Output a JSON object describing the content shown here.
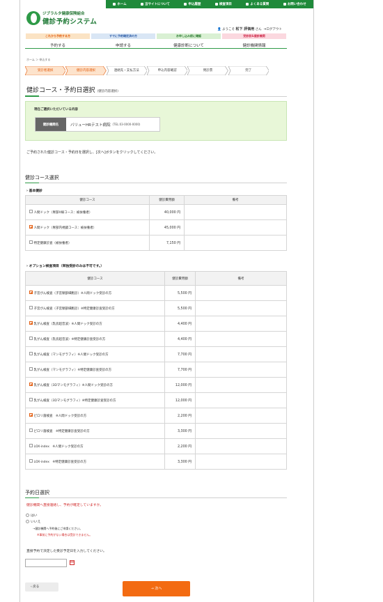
{
  "topnav": [
    "ホーム",
    "当サイトについて",
    "申込履歴",
    "検査項目",
    "よくある質問",
    "お問い合わせ"
  ],
  "logo": {
    "sub": "ジブラルタ健康保険組合",
    "title": "健診予約システム",
    "mark": "Health Check"
  },
  "user": {
    "prefix": "ようこそ",
    "name": "松下 評価用",
    "suffix": "さん",
    "logout": "ログアウト"
  },
  "menu": [
    {
      "tag": "これから予約する方",
      "label": "予約する"
    },
    {
      "tag": "すでに予約確定済の方",
      "label": "申請する"
    },
    {
      "tag": "お申し込み前に確認",
      "label": "健康診断について"
    },
    {
      "tag": "受診前&健診機関",
      "label": "健診機関情報"
    }
  ],
  "breadcrumb": "ホーム ＞ 申込する",
  "steps": [
    "受診者選択",
    "健診内容選択",
    "連絡先・支払方法",
    "申込内容確認",
    "問診票",
    "完了"
  ],
  "page": {
    "title": "健診コース・予約日選択",
    "title_note": "(健診内容選択)"
  },
  "selection": {
    "caption": "現在ご選択いただいている内容",
    "key": "健診機関名",
    "hospital": "バリューHRテスト病院",
    "tel": "(TEL:03-0000-0000)"
  },
  "intro": "ご予約された健診コース・予約日を選択し、[次へ]ボタンをクリックしてください。",
  "course_section": "健診コース選択",
  "basic": {
    "heading": "基本健診",
    "headers": [
      "健診コース",
      "健診費用額",
      "備考"
    ],
    "rows": [
      {
        "name": "人間ドック（胃部X線コース：被扶養者）",
        "price": "40,000 円",
        "checked": false
      },
      {
        "name": "人間ドック（胃部内視鏡コース：被扶養者）",
        "price": "45,000 円",
        "checked": true
      },
      {
        "name": "特定健康診査（被扶養者）",
        "price": "7,150 円",
        "checked": false
      }
    ]
  },
  "option": {
    "heading": "オプション検査項目（単独受診のみは不可です。）",
    "headers": [
      "健診コース",
      "健診費用額",
      "備考"
    ],
    "rows": [
      {
        "name": "子宮がん検査（子宮頸部細胞診）※人間ドック受診の方",
        "price": "5,500 円",
        "checked": true
      },
      {
        "name": "子宮がん検査（子宮頸部細胞診）※特定健康診査受診の方",
        "price": "5,500 円",
        "checked": false
      },
      {
        "name": "乳がん検査（乳房超音波）※人間ドック受診の方",
        "price": "4,400 円",
        "checked": true
      },
      {
        "name": "乳がん検査（乳房超音波）※特定健康診査受診の方",
        "price": "4,400 円",
        "checked": false
      },
      {
        "name": "乳がん検査（マンモグラフィ）※人間ドック受診の方",
        "price": "7,700 円",
        "checked": false
      },
      {
        "name": "乳がん検査（マンモグラフィ）※特定健康診査受診の方",
        "price": "7,700 円",
        "checked": false
      },
      {
        "name": "乳がん検査（3Dマンモグラフィ）※人間ドック受診の方",
        "price": "12,000 円",
        "checked": true
      },
      {
        "name": "乳がん検査（3Dマンモグラフィ）※特定健康診査受診の方",
        "price": "12,000 円",
        "checked": false
      },
      {
        "name": "ピロリ菌検査　※人間ドック受診の方",
        "price": "2,200 円",
        "checked": true
      },
      {
        "name": "ピロリ菌検査　※特定健康診査受診の方",
        "price": "3,300 円",
        "checked": false
      },
      {
        "name": "LOX-index　※人間ドック受診の方",
        "price": "2,200 円",
        "checked": false
      },
      {
        "name": "LOX-index　※特定健康診査受診の方",
        "price": "3,300 円",
        "checked": false
      }
    ]
  },
  "reserve": {
    "section": "予約日選択",
    "note": "健診機関へ直接連絡し、予約が確定していますか。",
    "yes": "はい",
    "no": "いいえ",
    "no_note1": "→健診機関へ予約後にご申請ください。",
    "no_note2": "※事前に予約がない場合は受診できません。",
    "direct": "直接予約で決定した受診予定日を入力してください。"
  },
  "buttons": {
    "back": "‹  戻る",
    "next": "→  次へ"
  },
  "colors": {
    "brand": "#1f8a3a",
    "accent": "#f36b12",
    "alert": "#d12b2b"
  }
}
